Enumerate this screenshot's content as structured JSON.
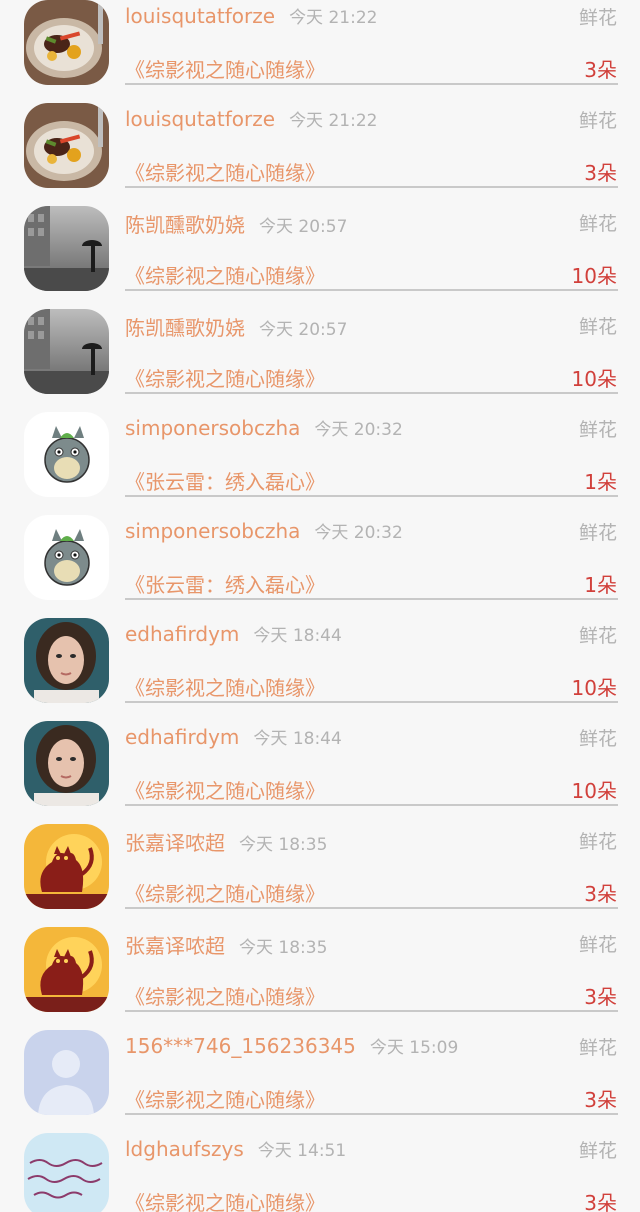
{
  "gift_list": {
    "items": [
      {
        "name": "louisqutatforze",
        "time": "今天 21:22",
        "gift": "鲜花",
        "book": "《综影视之随心随缘》",
        "count": "3朵",
        "avatar": "food-photo-icon"
      },
      {
        "name": "louisqutatforze",
        "time": "今天 21:22",
        "gift": "鲜花",
        "book": "《综影视之随心随缘》",
        "count": "3朵",
        "avatar": "food-photo-icon"
      },
      {
        "name": "陈凯醺歌奶娆",
        "time": "今天 20:57",
        "gift": "鲜花",
        "book": "《综影视之随心随缘》",
        "count": "10朵",
        "avatar": "rainy-street-photo-icon"
      },
      {
        "name": "陈凯醺歌奶娆",
        "time": "今天 20:57",
        "gift": "鲜花",
        "book": "《综影视之随心随缘》",
        "count": "10朵",
        "avatar": "rainy-street-photo-icon"
      },
      {
        "name": "simponersobczha",
        "time": "今天 20:32",
        "gift": "鲜花",
        "book": "《张云雷：绣入磊心》",
        "count": "1朵",
        "avatar": "totoro-cartoon-icon"
      },
      {
        "name": "simponersobczha",
        "time": "今天 20:32",
        "gift": "鲜花",
        "book": "《张云雷：绣入磊心》",
        "count": "1朵",
        "avatar": "totoro-cartoon-icon"
      },
      {
        "name": "edhafirdym",
        "time": "今天 18:44",
        "gift": "鲜花",
        "book": "《综影视之随心随缘》",
        "count": "10朵",
        "avatar": "woman-portrait-icon"
      },
      {
        "name": "edhafirdym",
        "time": "今天 18:44",
        "gift": "鲜花",
        "book": "《综影视之随心随缘》",
        "count": "10朵",
        "avatar": "woman-portrait-icon"
      },
      {
        "name": "张嘉译哝超",
        "time": "今天 18:35",
        "gift": "鲜花",
        "book": "《综影视之随心随缘》",
        "count": "3朵",
        "avatar": "halloween-cat-icon"
      },
      {
        "name": "张嘉译哝超",
        "time": "今天 18:35",
        "gift": "鲜花",
        "book": "《综影视之随心随缘》",
        "count": "3朵",
        "avatar": "halloween-cat-icon"
      },
      {
        "name": "156***746_156236345",
        "time": "今天 15:09",
        "gift": "鲜花",
        "book": "《综影视之随心随缘》",
        "count": "3朵",
        "avatar": "default-user-silhouette-icon"
      },
      {
        "name": "ldghaufszys",
        "time": "今天 14:51",
        "gift": "鲜花",
        "book": "《综影视之随心随缘》",
        "count": "3朵",
        "avatar": "handwriting-image-icon"
      }
    ]
  },
  "colors": {
    "name_text": "#e8966a",
    "time_text": "#b3b3b3",
    "count_text": "#d1403b",
    "divider": "#c9c9c9",
    "background": "#f7f7f7"
  }
}
